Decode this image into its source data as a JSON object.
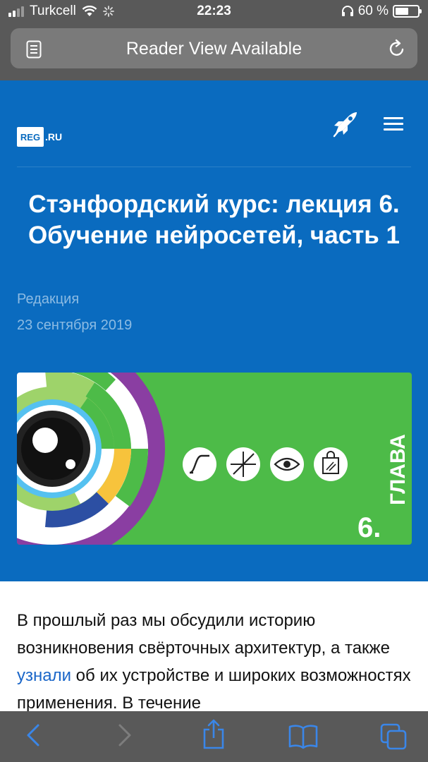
{
  "status": {
    "carrier": "Turkcell",
    "time": "22:23",
    "battery_percent": "60 %",
    "battery_level": 0.6
  },
  "address_bar": {
    "text": "Reader View Available"
  },
  "site": {
    "logo_box": "REG",
    "logo_suffix": ".RU"
  },
  "article": {
    "title": "Стэнфордский курс: лекция 6. Обучение нейросетей, часть 1",
    "author": "Редакция",
    "date": "23 сентября 2019",
    "banner_text": "6.",
    "banner_word": "ГЛАВА",
    "body_before_link": "В прошлый раз мы обсудили историю возникновения свёрточных архитектур, а также ",
    "body_link": "узнали",
    "body_after_link": " об их устройстве и широких возможностях применения. В течение"
  },
  "colors": {
    "header_blue": "#0a6bbf",
    "banner_green": "#4dbb48",
    "browser_chrome": "#595959",
    "link_blue": "#1a66c8"
  },
  "toolbar": {
    "icons": [
      "back-icon",
      "forward-icon",
      "share-icon",
      "bookmarks-icon",
      "tabs-icon"
    ]
  }
}
